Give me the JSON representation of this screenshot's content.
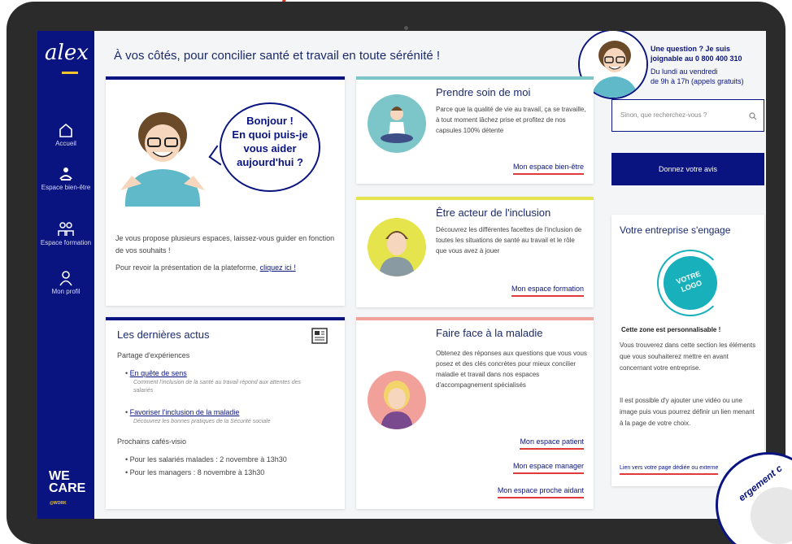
{
  "sidebar": {
    "logo": "alex",
    "items": [
      {
        "label": "Accueil",
        "icon": "home-icon"
      },
      {
        "label": "Espace bien-être",
        "icon": "wellbeing-icon"
      },
      {
        "label": "Espace formation",
        "icon": "training-icon"
      },
      {
        "label": "Mon profil",
        "icon": "profile-icon"
      }
    ],
    "brand_line1": "WE",
    "brand_line2": "CARE",
    "brand_sub": "@WORK"
  },
  "header": {
    "tagline": "À vos côtés, pour concilier santé et travail en toute sérénité !"
  },
  "contact": {
    "line1": "Une question ? Je suis",
    "line2": "joignable au 0 800 400 310",
    "line3": "Du lundi au vendredi",
    "line4": "de 9h à 17h (appels gratuits)"
  },
  "welcome": {
    "bubble_line1": "Bonjour !",
    "bubble_line2": "En quoi puis-je",
    "bubble_line3": "vous aider",
    "bubble_line4": "aujourd'hui ?",
    "intro": "Je vous propose plusieurs espaces, laissez-vous guider en fonction de vos souhaits !",
    "review_text": "Pour revoir la présentation de la plateforme, ",
    "review_link": "cliquez ici !"
  },
  "news": {
    "title": "Les dernières actus",
    "section1": "Partage d'expériences",
    "item1_link": "En quête de sens",
    "item1_desc": "Comment l'inclusion de la santé au travail répond aux attentes des salariés",
    "item2_link": "Favoriser l'inclusion de la maladie",
    "item2_desc": "Découvrez les bonnes pratiques de la Sécurité sociale",
    "section2": "Prochains cafés-visio",
    "event1": "Pour les salariés malades : 2 novembre à 13h30",
    "event2": "Pour les managers : 8 novembre à 13h30"
  },
  "cards": [
    {
      "title": "Prendre soin de moi",
      "text": "Parce que la qualité de vie au travail, ça se travaille, à tout moment lâchez prise et profitez de nos capsules 100% détente",
      "cta": "Mon espace bien-être",
      "accent": "#7cc6c9"
    },
    {
      "title": "Être acteur de l'inclusion",
      "text": "Découvrez les différentes facettes de l'inclusion de toutes les situations de santé au travail et le rôle que vous avez à jouer",
      "cta": "Mon espace formation",
      "accent": "#e6e44c"
    },
    {
      "title": "Faire face à la maladie",
      "text": "Obtenez des réponses aux questions que vous vous posez et des clés concrètes pour mieux concilier maladie et travail dans nos espaces d'accompagnement spécialisés",
      "cta1": "Mon espace patient",
      "cta2": "Mon espace manager",
      "cta3": "Mon espace proche aidant",
      "accent": "#f2a09a"
    }
  ],
  "search": {
    "placeholder": "Sinon, que recherchez-vous ?"
  },
  "feedback_button": "Donnez votre avis",
  "company": {
    "title": "Votre entreprise s'engage",
    "logo_text_1": "VOTRE",
    "logo_text_2": "LOGO",
    "bold": "Cette zone est personnalisable !",
    "p1": "Vous trouverez dans cette section les éléments que vous souhaiterez mettre en avant concernant votre entreprise.",
    "p2": "Il est possible d'y ajouter une vidéo ou une image puis vous pourrez définir un lien menant à la page de votre choix.",
    "link": "Lien vers votre page dédiée ou externe"
  },
  "stamp": {
    "text": "ergement c"
  },
  "colors": {
    "navy": "#0a1480",
    "yellow": "#f3c52a",
    "teal": "#17b0bb",
    "red": "#e03a3a"
  }
}
